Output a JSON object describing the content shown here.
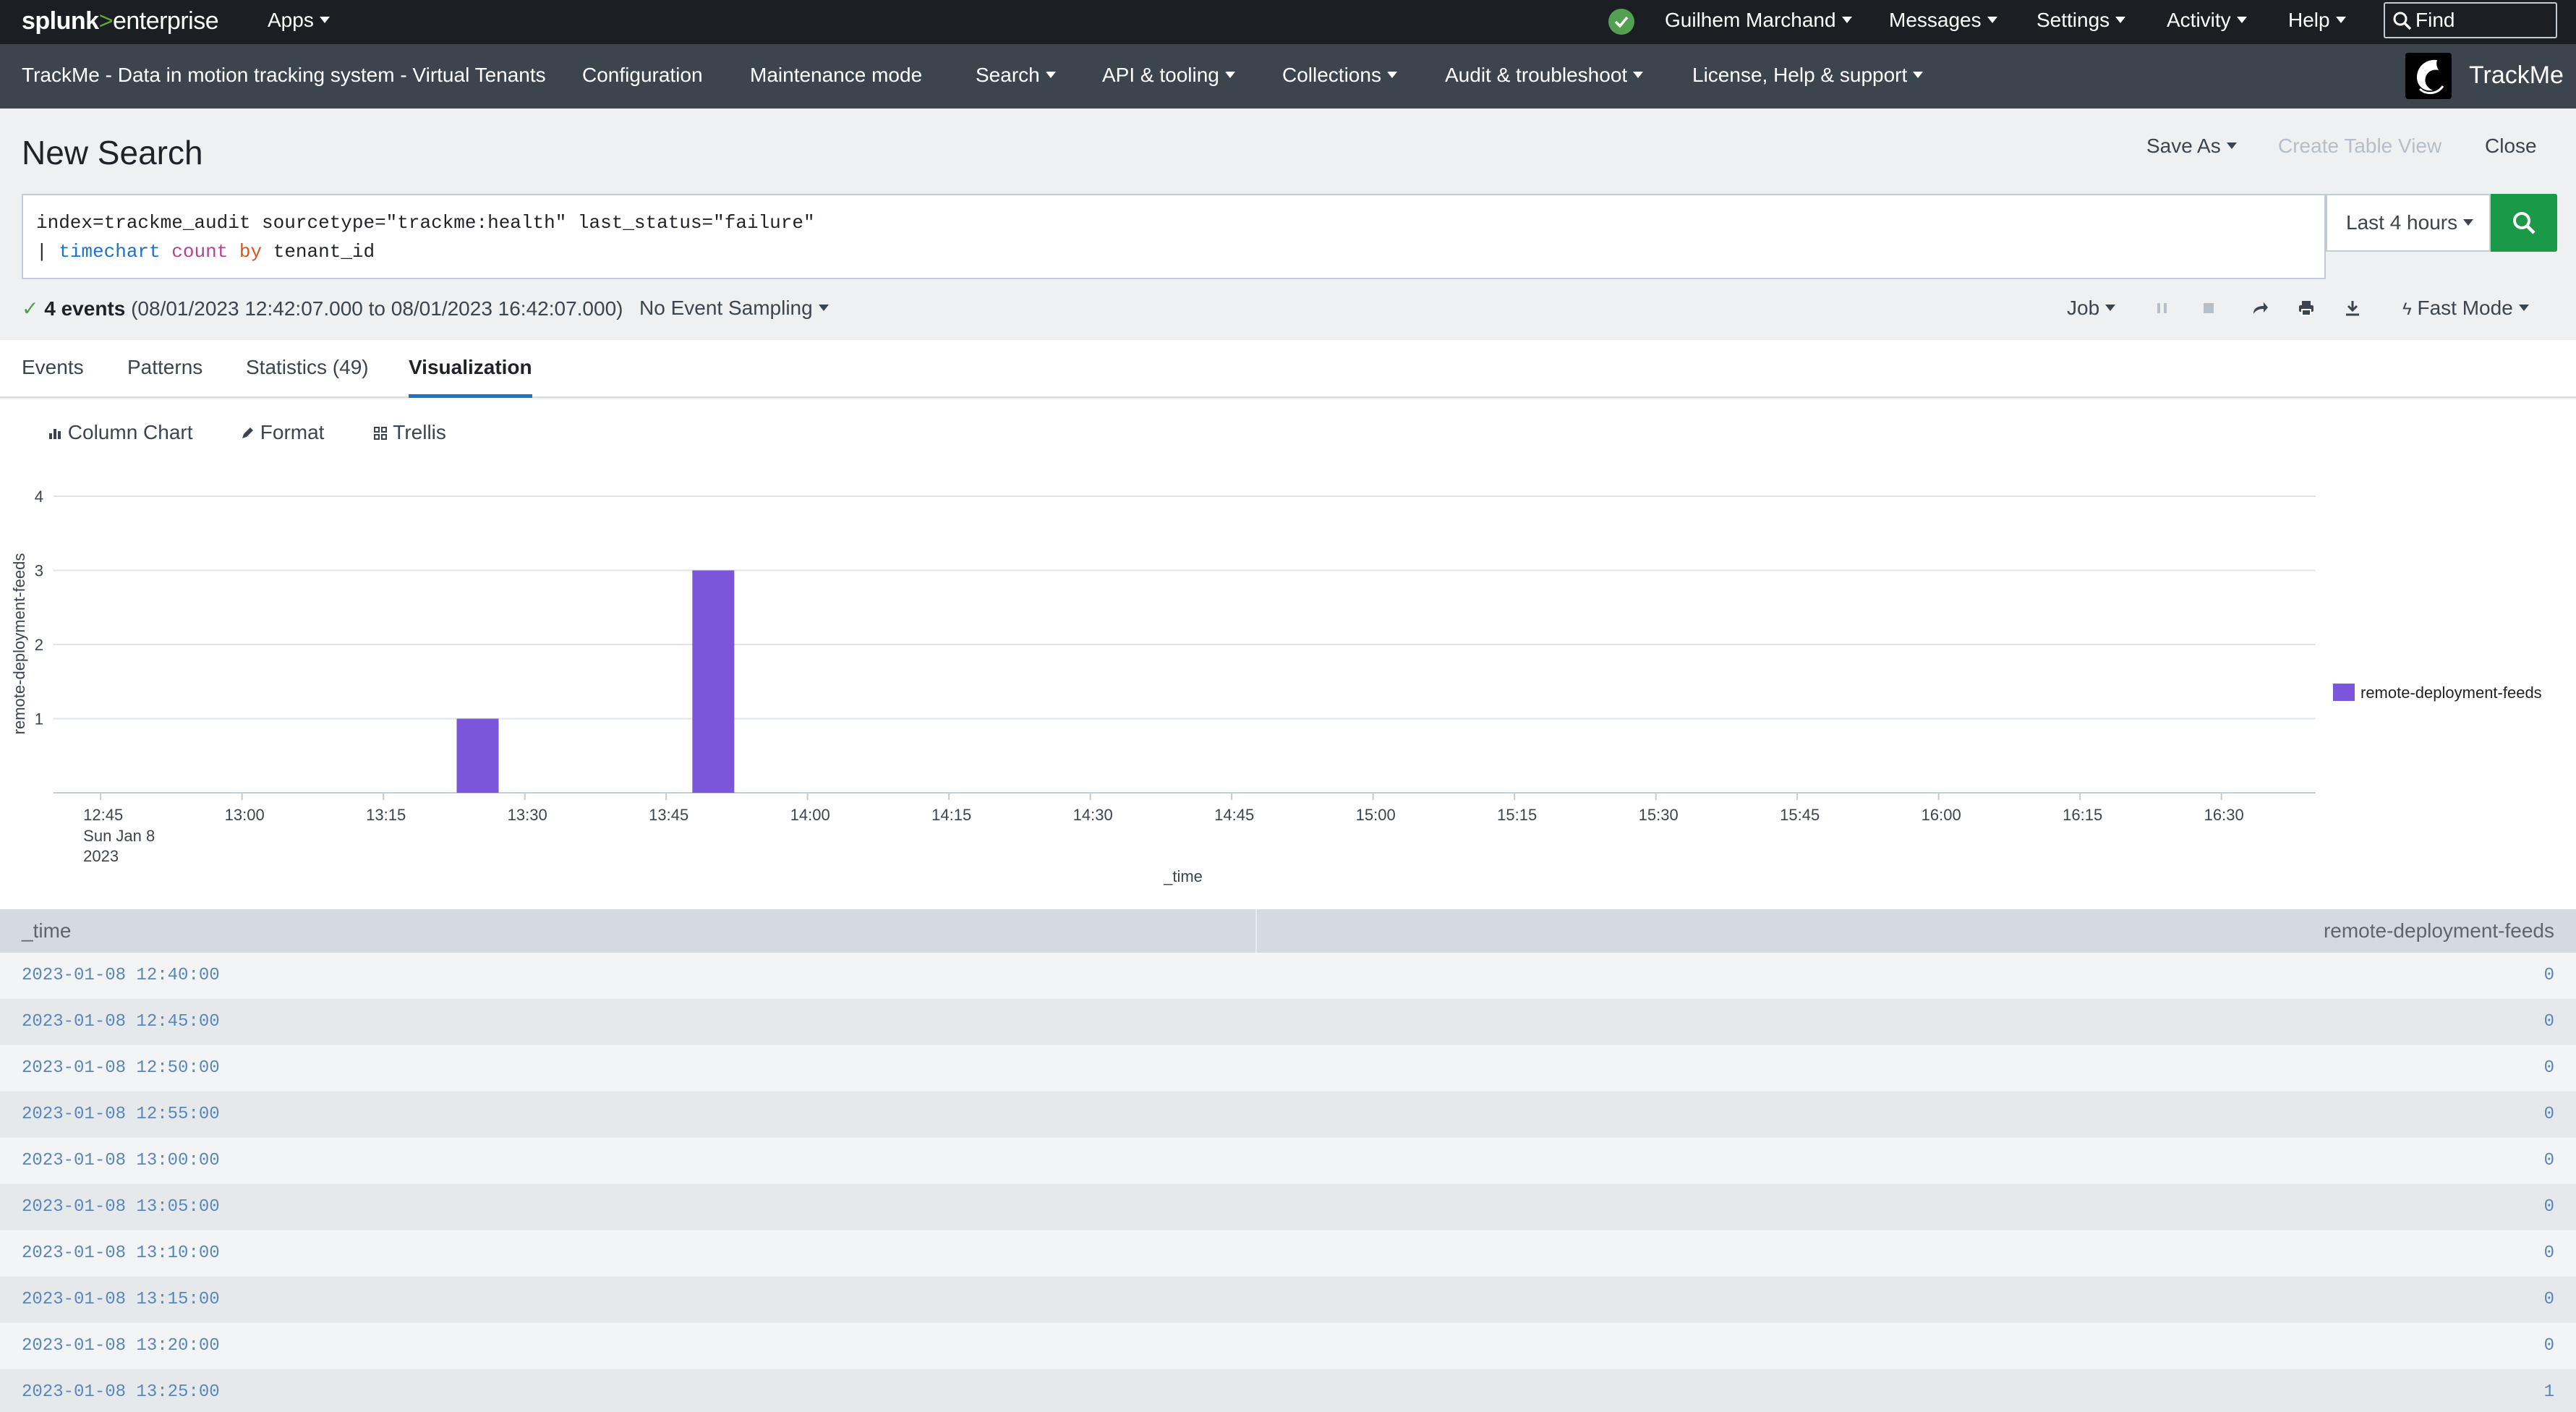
{
  "topbar": {
    "logo_splunk": "splunk",
    "logo_gt": ">",
    "logo_enterprise": "enterprise",
    "apps": "Apps",
    "user": "Guilhem Marchand",
    "messages": "Messages",
    "settings": "Settings",
    "activity": "Activity",
    "help": "Help",
    "find_placeholder": "Find"
  },
  "appnav": {
    "items": [
      "TrackMe - Data in motion tracking system - Virtual Tenants",
      "Configuration",
      "Maintenance mode",
      "Search",
      "API & tooling",
      "Collections",
      "Audit & troubleshoot",
      "License, Help & support"
    ],
    "brand": "TrackMe"
  },
  "page": {
    "title": "New Search",
    "save_as": "Save As",
    "create_table_view": "Create Table View",
    "close": "Close"
  },
  "search": {
    "line1": "index=trackme_audit sourcetype=\"trackme:health\" last_status=\"failure\"",
    "pipe": "| ",
    "cmd": "timechart",
    "func": "count",
    "by": "by",
    "field": "tenant_id",
    "time_range": "Last 4 hours"
  },
  "status": {
    "check": "✓",
    "events": "4 events",
    "range": "(08/01/2023 12:42:07.000 to 08/01/2023 16:42:07.000)",
    "sampling": "No Event Sampling",
    "job": "Job",
    "mode": "Fast Mode"
  },
  "tabs": [
    "Events",
    "Patterns",
    "Statistics (49)",
    "Visualization"
  ],
  "viz_toolbar": {
    "chart_type": "Column Chart",
    "format": "Format",
    "trellis": "Trellis"
  },
  "chart_data": {
    "type": "bar",
    "ylabel": "remote-deployment-feeds",
    "xlabel": "_time",
    "ylim": [
      0,
      4
    ],
    "yticks": [
      "1",
      "2",
      "3",
      "4"
    ],
    "xticks": [
      "12:45",
      "13:00",
      "13:15",
      "13:30",
      "13:45",
      "14:00",
      "14:15",
      "14:30",
      "14:45",
      "15:00",
      "15:15",
      "15:30",
      "15:45",
      "16:00",
      "16:15",
      "16:30"
    ],
    "first_tick_date": [
      "Sun Jan 8",
      "2023"
    ],
    "series": [
      {
        "name": "remote-deployment-feeds",
        "color": "#7b56db",
        "points": [
          {
            "time": "13:25",
            "value": 1
          },
          {
            "time": "13:50",
            "value": 3
          }
        ]
      }
    ]
  },
  "table": {
    "headers": [
      "_time",
      "remote-deployment-feeds"
    ],
    "rows": [
      [
        "2023-01-08 12:40:00",
        "0"
      ],
      [
        "2023-01-08 12:45:00",
        "0"
      ],
      [
        "2023-01-08 12:50:00",
        "0"
      ],
      [
        "2023-01-08 12:55:00",
        "0"
      ],
      [
        "2023-01-08 13:00:00",
        "0"
      ],
      [
        "2023-01-08 13:05:00",
        "0"
      ],
      [
        "2023-01-08 13:10:00",
        "0"
      ],
      [
        "2023-01-08 13:15:00",
        "0"
      ],
      [
        "2023-01-08 13:20:00",
        "0"
      ],
      [
        "2023-01-08 13:25:00",
        "1"
      ]
    ]
  }
}
